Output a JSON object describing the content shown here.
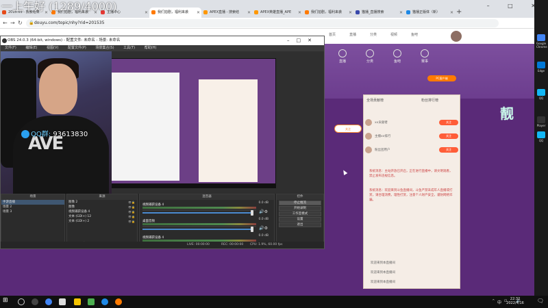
{
  "overlay": {
    "text": "一上午好 (1289/4000)"
  },
  "browser": {
    "tabs": [
      {
        "title": "2015.03 - 搜索结果",
        "color": "#e64a19"
      },
      {
        "title": "我们拍剧，福利来袭",
        "color": "#ff7a00"
      },
      {
        "title": "主播中心",
        "color": "#e53935"
      },
      {
        "title": "我们拍剧，福利来袭",
        "color": "#ff7a00"
      },
      {
        "title": "APEX直播 - 搜索结",
        "color": "#ff9800"
      },
      {
        "title": "APEX英雄直播_APE",
        "color": "#ff9800"
      },
      {
        "title": "我们拍剧，福利来袭",
        "color": "#ff7a00"
      },
      {
        "title": "猫播_直播搜索",
        "color": "#3949ab"
      },
      {
        "title": "猫播正版体（新）",
        "color": "#1e88e5"
      }
    ],
    "new_tab": "+",
    "window_controls": "– □ ✕",
    "url": "douyu.com/topic/nhy?rid=201535",
    "nav": {
      "back": "←",
      "forward": "→",
      "reload": "↻"
    }
  },
  "site": {
    "links": [
      "首页",
      "直播",
      "分类",
      "视频",
      "鱼吧"
    ],
    "banner_icons": [
      "直播",
      "分类",
      "鱼吧",
      "赛事"
    ],
    "pc_client": "PC客户端",
    "fav_label": "关注",
    "chat": {
      "tabs": [
        "全场贡献榜",
        "粉丝排行榜"
      ],
      "rows": [
        {
          "name": "xx贡献者",
          "btn": "关注"
        },
        {
          "name": "主播xx排行",
          "btn": "关注"
        },
        {
          "name": "粉丝团用户",
          "btn": "关注"
        }
      ],
      "system_1": "系统消息：主站开放已开启，正在进行直播中，请文明观看，禁止发布违规信息。",
      "system_2": "系统消息：欢迎来到斗鱼直播间，斗鱼严禁未成年人直播或打赏，请合理消费，理性打赏，注意个人财产安全，谨防网络诈骗。",
      "lines": [
        "欢迎来到本直播间",
        "欢迎来到本直播间",
        "欢迎来到本直播间"
      ]
    }
  },
  "desktop_right": [
    "Google Chrome",
    "Edge",
    "QQ",
    "Player",
    "QQ"
  ],
  "obs": {
    "title": "OBS 24.0.3 (64-bit, windows) - 配置文件: 未命名 - 场景: 未命名",
    "menu": [
      "文件(F)",
      "编辑(E)",
      "视图(V)",
      "配置文件(P)",
      "场景集合(S)",
      "工具(T)",
      "帮助(H)"
    ],
    "webcam_badge": {
      "prefix": "QQ群:",
      "number": "93613830"
    },
    "docks": {
      "scenes_title": "场景",
      "scenes": [
        "手游直播",
        "场景 2",
        "场景 3"
      ],
      "sources_title": "来源",
      "sources": [
        "图像 2",
        "图像",
        "视频捕获设备 4",
        "文本 (GDI+) 12",
        "文本 (GDI+) 2"
      ],
      "mixer_title": "混音器",
      "mixer": [
        {
          "name": "视频捕获设备 4",
          "db": "0.0 dB"
        },
        {
          "name": "桌面音频",
          "db": "0.0 dB"
        },
        {
          "name": "视频捕获设备 4",
          "db": "0.0 dB"
        }
      ],
      "controls_title": "控件",
      "controls": [
        "停止推流",
        "开始录制",
        "工作室模式",
        "设置",
        "退出"
      ],
      "tabs": [
        "控件",
        "转场特效"
      ]
    },
    "status": {
      "live": "LIVE: 00:00:00",
      "rec": "REC: 00:00:00",
      "cpu": "CPU: 1.9%, 60.00 fps"
    }
  },
  "taskbar": {
    "ime": "中",
    "time": "22:32",
    "date": "2022/4/16"
  }
}
